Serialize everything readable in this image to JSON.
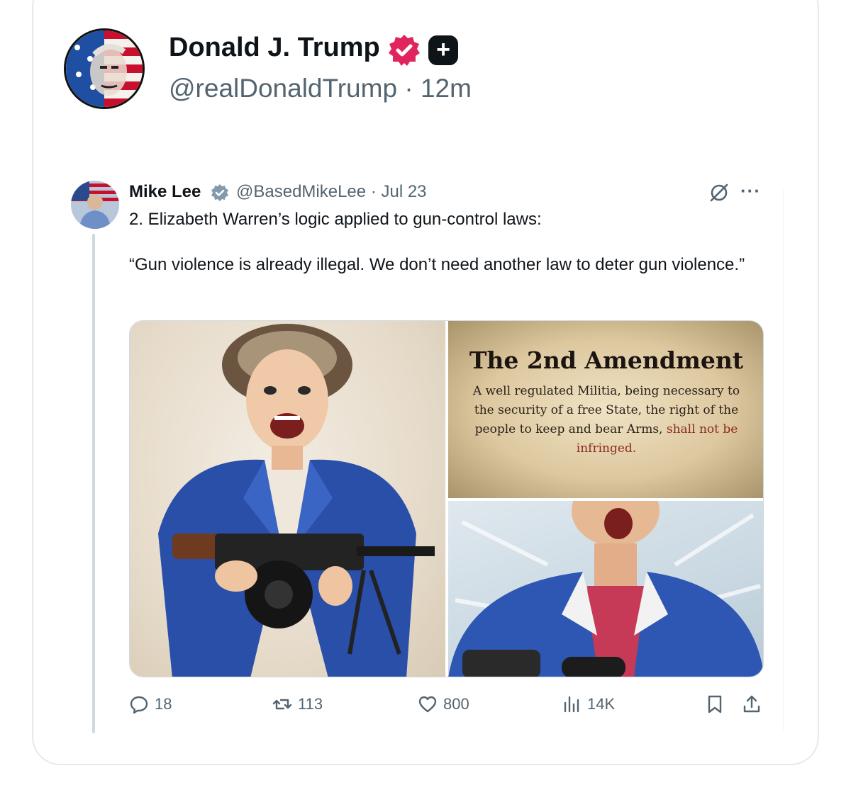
{
  "post": {
    "author_name": "Donald J. Trump",
    "handle": "@realDonaldTrump",
    "separator": "·",
    "time": "12m"
  },
  "quote": {
    "author_name": "Mike Lee",
    "handle": "@BasedMikeLee",
    "separator": "·",
    "date": "Jul 23",
    "text_lines": [
      "2. Elizabeth Warren’s logic applied to gun-control laws:",
      "“Gun violence is already illegal. We don’t need another law to deter gun violence.”"
    ],
    "media": {
      "amendment_title": "The 2nd Amendment",
      "amendment_text": "A well regulated Militia, being necessary to the security of a free State, the right of the people to keep and bear Arms,",
      "amendment_emphasis": "shall not be infringed."
    },
    "stats": {
      "replies": "18",
      "reposts": "113",
      "likes": "800",
      "views": "14K"
    }
  },
  "colors": {
    "verified_pink": "#e0245e",
    "text_primary": "#0f1419",
    "text_secondary": "#536471",
    "verified_blue": "#829aab",
    "thread_line": "#cfd9de"
  }
}
